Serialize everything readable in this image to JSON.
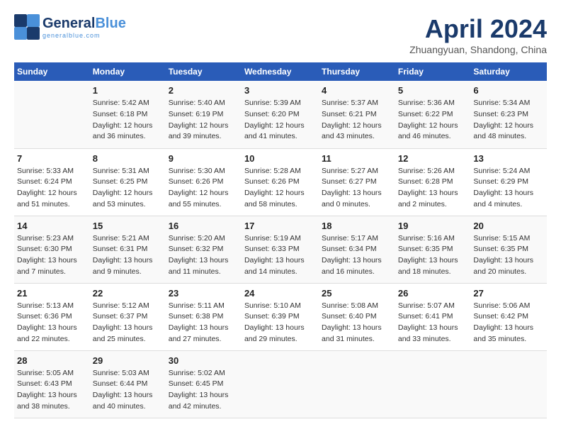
{
  "header": {
    "logo_general": "General",
    "logo_blue": "Blue",
    "logo_sub": "generalblue.com",
    "month_title": "April 2024",
    "location": "Zhuangyuan, Shandong, China"
  },
  "weekdays": [
    "Sunday",
    "Monday",
    "Tuesday",
    "Wednesday",
    "Thursday",
    "Friday",
    "Saturday"
  ],
  "weeks": [
    [
      {
        "day": "",
        "info": ""
      },
      {
        "day": "1",
        "info": "Sunrise: 5:42 AM\nSunset: 6:18 PM\nDaylight: 12 hours\nand 36 minutes."
      },
      {
        "day": "2",
        "info": "Sunrise: 5:40 AM\nSunset: 6:19 PM\nDaylight: 12 hours\nand 39 minutes."
      },
      {
        "day": "3",
        "info": "Sunrise: 5:39 AM\nSunset: 6:20 PM\nDaylight: 12 hours\nand 41 minutes."
      },
      {
        "day": "4",
        "info": "Sunrise: 5:37 AM\nSunset: 6:21 PM\nDaylight: 12 hours\nand 43 minutes."
      },
      {
        "day": "5",
        "info": "Sunrise: 5:36 AM\nSunset: 6:22 PM\nDaylight: 12 hours\nand 46 minutes."
      },
      {
        "day": "6",
        "info": "Sunrise: 5:34 AM\nSunset: 6:23 PM\nDaylight: 12 hours\nand 48 minutes."
      }
    ],
    [
      {
        "day": "7",
        "info": "Sunrise: 5:33 AM\nSunset: 6:24 PM\nDaylight: 12 hours\nand 51 minutes."
      },
      {
        "day": "8",
        "info": "Sunrise: 5:31 AM\nSunset: 6:25 PM\nDaylight: 12 hours\nand 53 minutes."
      },
      {
        "day": "9",
        "info": "Sunrise: 5:30 AM\nSunset: 6:26 PM\nDaylight: 12 hours\nand 55 minutes."
      },
      {
        "day": "10",
        "info": "Sunrise: 5:28 AM\nSunset: 6:26 PM\nDaylight: 12 hours\nand 58 minutes."
      },
      {
        "day": "11",
        "info": "Sunrise: 5:27 AM\nSunset: 6:27 PM\nDaylight: 13 hours\nand 0 minutes."
      },
      {
        "day": "12",
        "info": "Sunrise: 5:26 AM\nSunset: 6:28 PM\nDaylight: 13 hours\nand 2 minutes."
      },
      {
        "day": "13",
        "info": "Sunrise: 5:24 AM\nSunset: 6:29 PM\nDaylight: 13 hours\nand 4 minutes."
      }
    ],
    [
      {
        "day": "14",
        "info": "Sunrise: 5:23 AM\nSunset: 6:30 PM\nDaylight: 13 hours\nand 7 minutes."
      },
      {
        "day": "15",
        "info": "Sunrise: 5:21 AM\nSunset: 6:31 PM\nDaylight: 13 hours\nand 9 minutes."
      },
      {
        "day": "16",
        "info": "Sunrise: 5:20 AM\nSunset: 6:32 PM\nDaylight: 13 hours\nand 11 minutes."
      },
      {
        "day": "17",
        "info": "Sunrise: 5:19 AM\nSunset: 6:33 PM\nDaylight: 13 hours\nand 14 minutes."
      },
      {
        "day": "18",
        "info": "Sunrise: 5:17 AM\nSunset: 6:34 PM\nDaylight: 13 hours\nand 16 minutes."
      },
      {
        "day": "19",
        "info": "Sunrise: 5:16 AM\nSunset: 6:35 PM\nDaylight: 13 hours\nand 18 minutes."
      },
      {
        "day": "20",
        "info": "Sunrise: 5:15 AM\nSunset: 6:35 PM\nDaylight: 13 hours\nand 20 minutes."
      }
    ],
    [
      {
        "day": "21",
        "info": "Sunrise: 5:13 AM\nSunset: 6:36 PM\nDaylight: 13 hours\nand 22 minutes."
      },
      {
        "day": "22",
        "info": "Sunrise: 5:12 AM\nSunset: 6:37 PM\nDaylight: 13 hours\nand 25 minutes."
      },
      {
        "day": "23",
        "info": "Sunrise: 5:11 AM\nSunset: 6:38 PM\nDaylight: 13 hours\nand 27 minutes."
      },
      {
        "day": "24",
        "info": "Sunrise: 5:10 AM\nSunset: 6:39 PM\nDaylight: 13 hours\nand 29 minutes."
      },
      {
        "day": "25",
        "info": "Sunrise: 5:08 AM\nSunset: 6:40 PM\nDaylight: 13 hours\nand 31 minutes."
      },
      {
        "day": "26",
        "info": "Sunrise: 5:07 AM\nSunset: 6:41 PM\nDaylight: 13 hours\nand 33 minutes."
      },
      {
        "day": "27",
        "info": "Sunrise: 5:06 AM\nSunset: 6:42 PM\nDaylight: 13 hours\nand 35 minutes."
      }
    ],
    [
      {
        "day": "28",
        "info": "Sunrise: 5:05 AM\nSunset: 6:43 PM\nDaylight: 13 hours\nand 38 minutes."
      },
      {
        "day": "29",
        "info": "Sunrise: 5:03 AM\nSunset: 6:44 PM\nDaylight: 13 hours\nand 40 minutes."
      },
      {
        "day": "30",
        "info": "Sunrise: 5:02 AM\nSunset: 6:45 PM\nDaylight: 13 hours\nand 42 minutes."
      },
      {
        "day": "",
        "info": ""
      },
      {
        "day": "",
        "info": ""
      },
      {
        "day": "",
        "info": ""
      },
      {
        "day": "",
        "info": ""
      }
    ]
  ]
}
